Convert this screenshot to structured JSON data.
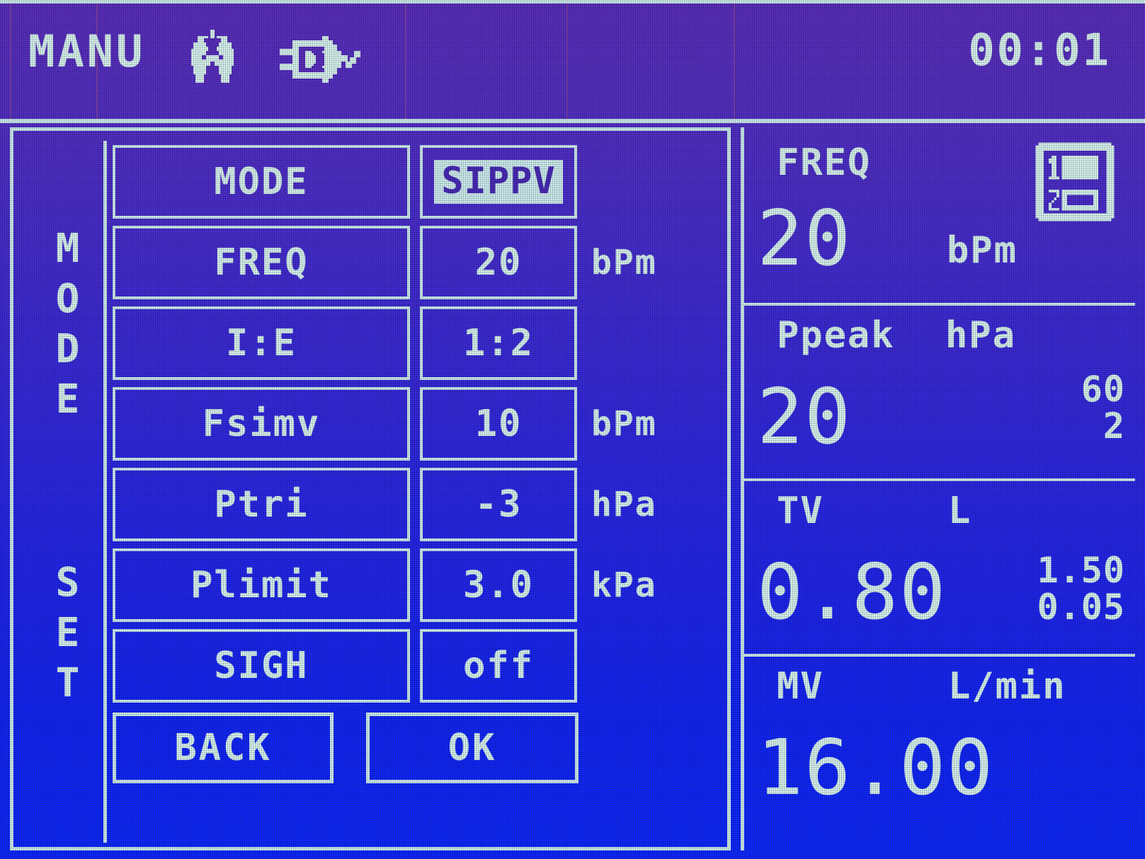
{
  "header": {
    "mode_label": "MANU",
    "clock": "00:01",
    "icons": [
      {
        "name": "lungs-icon",
        "label": "lungs"
      },
      {
        "name": "power-plug-icon",
        "label": "power-plug"
      }
    ]
  },
  "sidebar": {
    "labels": [
      "MODE",
      "SET"
    ]
  },
  "settings": {
    "rows": [
      {
        "label": "MODE",
        "value": "SIPPV",
        "unit": "",
        "highlighted": true
      },
      {
        "label": "FREQ",
        "value": "20",
        "unit": "bPm",
        "highlighted": false
      },
      {
        "label": "I:E",
        "value": "1:2",
        "unit": "",
        "highlighted": false
      },
      {
        "label": "Fsimv",
        "value": "10",
        "unit": "bPm",
        "highlighted": false
      },
      {
        "label": "Ptri",
        "value": "-3",
        "unit": "hPa",
        "highlighted": false
      },
      {
        "label": "Plimit",
        "value": "3.0",
        "unit": "kPa",
        "highlighted": false
      },
      {
        "label": "SIGH",
        "value": "off",
        "unit": "",
        "highlighted": false
      }
    ],
    "buttons": {
      "back": "BACK",
      "ok": "OK"
    }
  },
  "monitor": {
    "page_indicator": {
      "name": "page-select-icon",
      "active": "1",
      "inactive": "2"
    },
    "blocks": [
      {
        "title": "FREQ",
        "unit": "bPm",
        "value": "20",
        "limit_high": "",
        "limit_low": ""
      },
      {
        "title": "Ppeak",
        "unit": "hPa",
        "value": "20",
        "limit_high": "60",
        "limit_low": "2"
      },
      {
        "title": "TV",
        "unit": "L",
        "value": "0.80",
        "limit_high": "1.50",
        "limit_low": "0.05"
      },
      {
        "title": "MV",
        "unit": "L/min",
        "value": "16.00",
        "limit_high": "",
        "limit_low": ""
      }
    ]
  },
  "colors": {
    "lcd_text": "#d9f4f0",
    "bg_top": "#5b2fbe",
    "bg_bottom": "#0d28ff",
    "highlight_bg": "#cfeef0",
    "highlight_fg": "#4a2bb8"
  }
}
